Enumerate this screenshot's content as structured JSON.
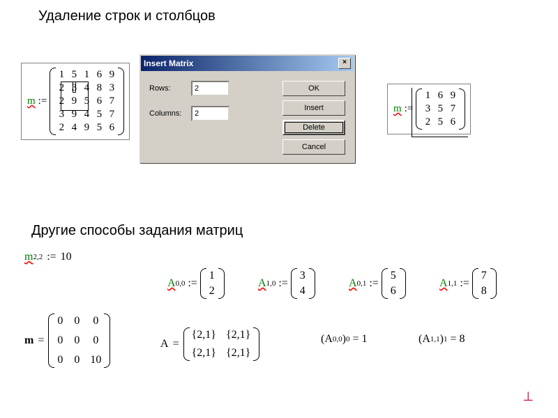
{
  "headings": {
    "h1": "Удаление строк и столбцов",
    "h2": "Другие способы задания матриц"
  },
  "matrix_left": {
    "var": "m",
    "op": ":=",
    "rows": [
      [
        "1",
        "5",
        "1",
        "6",
        "9"
      ],
      [
        "2",
        "3",
        "4",
        "8",
        "3"
      ],
      [
        "2",
        "9",
        "5",
        "6",
        "7"
      ],
      [
        "3",
        "9",
        "4",
        "5",
        "7"
      ],
      [
        "2",
        "4",
        "9",
        "5",
        "6"
      ]
    ]
  },
  "matrix_right": {
    "var": "m",
    "op": ":=",
    "rows": [
      [
        "1",
        "6",
        "9"
      ],
      [
        "3",
        "5",
        "7"
      ],
      [
        "2",
        "5",
        "6"
      ]
    ]
  },
  "dialog": {
    "title": "Insert Matrix",
    "close_glyph": "×",
    "rows_label": "Rows:",
    "cols_label": "Columns:",
    "rows_value": "2",
    "cols_value": "2",
    "buttons": {
      "ok": "OK",
      "insert": "Insert",
      "delete": "Delete",
      "cancel": "Cancel"
    }
  },
  "lower": {
    "assign_m22": {
      "var": "m",
      "sub": "2,2",
      "op": ":=",
      "val": "10"
    },
    "m_result": {
      "var": "m",
      "op": "=",
      "rows": [
        [
          "0",
          "0",
          "0"
        ],
        [
          "0",
          "0",
          "0"
        ],
        [
          "0",
          "0",
          "10"
        ]
      ]
    },
    "A_assigns": [
      {
        "sub": "0,0",
        "vec": [
          "1",
          "2"
        ]
      },
      {
        "sub": "1,0",
        "vec": [
          "3",
          "4"
        ]
      },
      {
        "sub": "0,1",
        "vec": [
          "5",
          "6"
        ]
      },
      {
        "sub": "1,1",
        "vec": [
          "7",
          "8"
        ]
      }
    ],
    "A_result": {
      "var": "A",
      "op": "=",
      "rows": [
        [
          "{2,1}",
          "{2,1}"
        ],
        [
          "{2,1}",
          "{2,1}"
        ]
      ]
    },
    "A_idx": [
      {
        "outer": "0,0",
        "inner": "0",
        "val": "1"
      },
      {
        "outer": "1,1",
        "inner": "1",
        "val": "8"
      }
    ]
  }
}
